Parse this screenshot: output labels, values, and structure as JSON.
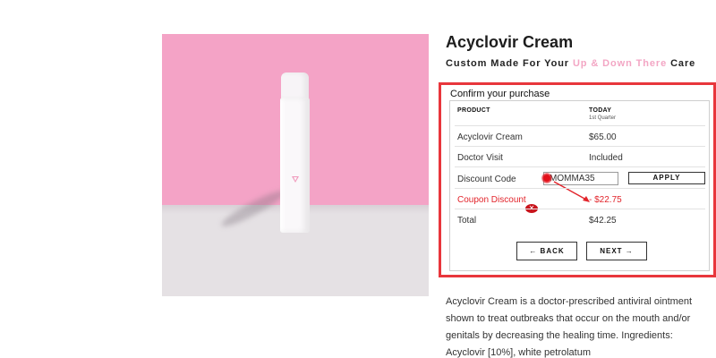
{
  "product": {
    "title": "Acyclovir Cream",
    "subtitle_prefix": "Custom Made For Your ",
    "subtitle_highlight": "Up & Down There",
    "subtitle_suffix": " Care",
    "description": "Acyclovir Cream is a doctor-prescribed antiviral ointment shown to treat outbreaks that occur on the mouth and/or genitals by decreasing the healing time. Ingredients: Acyclovir [10%], white petrolatum"
  },
  "confirm": {
    "title": "Confirm your purchase",
    "col_product": "PRODUCT",
    "col_today": "TODAY",
    "col_today_sub": "1st Quarter",
    "rows": [
      {
        "label": "Acyclovir Cream",
        "value": "$65.00"
      },
      {
        "label": "Doctor Visit",
        "value": "Included"
      }
    ],
    "discount_label": "Discount Code",
    "discount_value": "MOMMA35",
    "apply_label": "APPLY",
    "coupon_label": "Coupon Discount",
    "coupon_value": "- $22.75",
    "total_label": "Total",
    "total_value": "$42.25",
    "back_label": "← BACK",
    "next_label": "NEXT →"
  },
  "colors": {
    "accent_pink": "#f3a6c4",
    "highlight_red": "#e8363c"
  },
  "icons": {
    "remove": "close-icon"
  }
}
